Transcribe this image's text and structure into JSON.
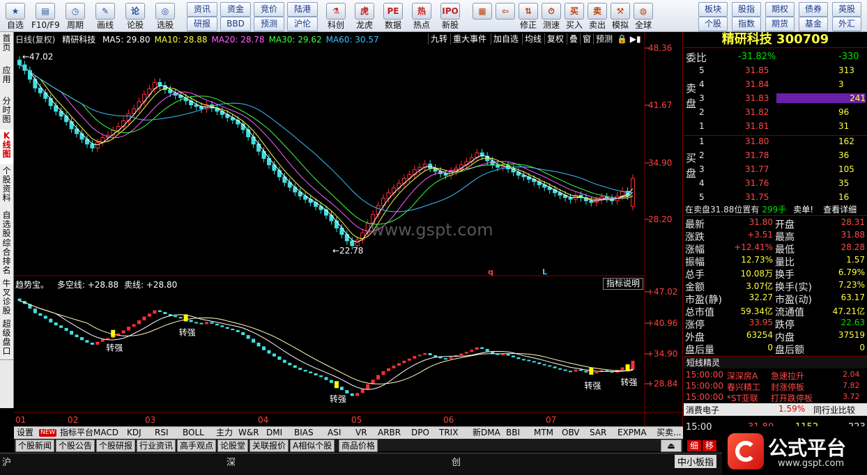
{
  "toolbar": {
    "buttons": [
      {
        "label": "自选",
        "icon": "★"
      },
      {
        "label": "F10/F9",
        "icon": "▤"
      },
      {
        "label": "周期",
        "icon": "◷"
      },
      {
        "label": "画线",
        "icon": "✎"
      },
      {
        "label": "论股",
        "icon": "论"
      },
      {
        "label": "选股",
        "icon": "◎"
      }
    ],
    "quick_links": [
      [
        "资讯",
        "研报"
      ],
      [
        "资金",
        "BBD"
      ],
      [
        "竞价",
        "预测"
      ],
      [
        "陆港",
        "沪伦"
      ]
    ],
    "buttons2": [
      {
        "label": "科创",
        "icon": "⚗"
      },
      {
        "label": "龙虎",
        "icon": "虎"
      },
      {
        "label": "数据",
        "icon": "PE"
      },
      {
        "label": "热点",
        "icon": "热"
      },
      {
        "label": "新股",
        "icon": "IPO"
      }
    ],
    "buttons3": [
      {
        "label": "",
        "icon": "▦"
      },
      {
        "label": "",
        "icon": "⇦"
      },
      {
        "label": "修正",
        "icon": "⇅"
      },
      {
        "label": "测速",
        "icon": "⏱"
      },
      {
        "label": "买入",
        "icon": "买"
      },
      {
        "label": "卖出",
        "icon": "卖"
      },
      {
        "label": "模拟",
        "icon": "⚒"
      },
      {
        "label": "全球",
        "icon": "◍"
      }
    ],
    "right_links": [
      [
        "板块",
        "个股"
      ],
      [
        "股指",
        "指数"
      ],
      [
        "期权",
        "期货"
      ],
      [
        "债券",
        "基金"
      ],
      [
        "英股",
        "外汇"
      ]
    ]
  },
  "left_tabs": [
    "首页",
    "应用",
    "分时图",
    "K线图",
    "个股资料",
    "自选股",
    "综合排名",
    "牛叉诊股",
    "超级盘口"
  ],
  "chart_header": {
    "period": "日线(复权)",
    "name": "精研科技",
    "ma": [
      {
        "label": "MA5: 29.80",
        "color": "#ffffff"
      },
      {
        "label": "MA10: 28.88",
        "color": "#ffff40"
      },
      {
        "label": "MA20: 28.78",
        "color": "#ff60ff"
      },
      {
        "label": "MA30: 29.62",
        "color": "#40ff40"
      },
      {
        "label": "MA60: 30.57",
        "color": "#40c0ff"
      }
    ],
    "tools": [
      "九转",
      "重大事件",
      "加自选",
      "均线",
      "复权",
      "叠",
      "窗",
      "预测"
    ]
  },
  "main_axis": [
    "48.36",
    "41.67",
    "34.90",
    "28.20"
  ],
  "sub_axis": [
    "+47.02",
    "+40.96",
    "+34.90",
    "+28.84"
  ],
  "annotations": {
    "high": "47.02",
    "low": "22.78",
    "watermark": "www.gspt.com",
    "q": "q",
    "L": "L"
  },
  "sub_header": {
    "title": "趋势宝。",
    "duo": "多空线: +28.88",
    "mai": "卖线: +28.80",
    "btn": "指标说明"
  },
  "signals": [
    "转强",
    "转强",
    "转强",
    "转强",
    "转强"
  ],
  "months": [
    "01",
    "02",
    "03",
    "04",
    "05",
    "06",
    "07"
  ],
  "chart_data": {
    "type": "candlestick",
    "closes": [
      46.0,
      45.3,
      44.2,
      43.1,
      42.5,
      41.8,
      40.9,
      40.2,
      39.6,
      38.9,
      38.0,
      37.4,
      36.7,
      36.1,
      35.6,
      36.3,
      36.9,
      37.2,
      37.8,
      38.3,
      39.0,
      39.9,
      40.5,
      41.4,
      42.3,
      43.0,
      43.8,
      43.4,
      42.9,
      42.5,
      42.2,
      41.9,
      41.5,
      41.0,
      40.8,
      40.5,
      41.0,
      40.6,
      40.2,
      39.8,
      39.4,
      39.1,
      38.6,
      37.9,
      37.0,
      36.1,
      35.2,
      34.3,
      33.5,
      32.8,
      32.0,
      31.3,
      30.7,
      30.1,
      29.6,
      29.2,
      28.8,
      28.3,
      27.9,
      27.2,
      26.5,
      25.6,
      24.8,
      24.0,
      23.4,
      24.1,
      25.0,
      26.2,
      27.3,
      28.4,
      29.3,
      30.0,
      30.6,
      31.2,
      31.8,
      32.3,
      32.9,
      33.2,
      33.6,
      33.1,
      32.7,
      32.4,
      32.2,
      32.7,
      33.1,
      33.5,
      33.9,
      34.4,
      35.0,
      34.6,
      34.0,
      33.5,
      33.2,
      33.4,
      33.0,
      32.6,
      32.2,
      32.0,
      31.7,
      31.4,
      31.0,
      30.7,
      30.4,
      30.0,
      29.7,
      29.4,
      29.2,
      29.7,
      29.4,
      29.0,
      28.8,
      29.1,
      29.5,
      29.3,
      29.0,
      29.6,
      30.2,
      29.6,
      31.8
    ],
    "ylim": [
      20.5,
      48.36
    ],
    "ma_values": {
      "MA5": 29.8,
      "MA10": 28.88,
      "MA20": 28.78,
      "MA30": 29.62,
      "MA60": 30.57
    },
    "high": 47.02,
    "low": 22.78
  },
  "quote": {
    "title": "精研科技 300709",
    "weibi_label": "委比",
    "weibi": "-31.82%",
    "weicha": "-330",
    "sell_label": "卖盘",
    "buy_label": "买盘",
    "sells": [
      [
        "5",
        "31.85",
        "313"
      ],
      [
        "4",
        "31.84",
        "3"
      ],
      [
        "3",
        "31.83",
        "241"
      ],
      [
        "2",
        "31.82",
        "96"
      ],
      [
        "1",
        "31.81",
        "31"
      ]
    ],
    "buys": [
      [
        "1",
        "31.80",
        "162"
      ],
      [
        "2",
        "31.78",
        "36"
      ],
      [
        "3",
        "31.77",
        "105"
      ],
      [
        "4",
        "31.76",
        "35"
      ],
      [
        "5",
        "31.75",
        "16"
      ]
    ],
    "notice": "在卖盘31.88位置有",
    "notice_vol": "299手",
    "notice_tag": "卖单!",
    "notice_link": "查看详细",
    "stats": [
      [
        "最新",
        "31.80",
        "开盘",
        "28.31"
      ],
      [
        "涨跌",
        "+3.51",
        "最高",
        "31.88"
      ],
      [
        "涨幅",
        "+12.41%",
        "最低",
        "28.28"
      ],
      [
        "振幅",
        "12.73%",
        "量比",
        "1.57"
      ],
      [
        "总手",
        "10.08万",
        "换手",
        "6.79%"
      ],
      [
        "金额",
        "3.07亿",
        "换手(实)",
        "7.23%"
      ],
      [
        "市盈(静)",
        "32.27",
        "市盈(动)",
        "63.17"
      ],
      [
        "总市值",
        "59.34亿",
        "流通值",
        "47.21亿"
      ],
      [
        "涨停",
        "33.95",
        "跌停",
        "22.63"
      ],
      [
        "外盘",
        "63254",
        "内盘",
        "37519"
      ],
      [
        "盘后量",
        "0",
        "盘后额",
        "0"
      ]
    ],
    "elf_title": "短线精灵",
    "elf": [
      [
        "15:00:00",
        "深深房A",
        "急速拉升",
        "2.04"
      ],
      [
        "15:00:00",
        "春兴精工",
        "封涨停板",
        "7.82"
      ],
      [
        "15:00:00",
        "*ST亚联",
        "打开跌停板",
        "3.72"
      ]
    ],
    "sector": "消费电子",
    "sector_pct": "1.59%",
    "sector_btn": "同行业比较",
    "tick": [
      "15:00",
      "31.80",
      "1152",
      "223"
    ],
    "detail_tabs": [
      "细",
      "移"
    ]
  },
  "indicator_tabs": [
    "设置",
    "NEW",
    "指标平台",
    "MACD",
    "KDJ",
    "RSI",
    "BOLL",
    "主力",
    "W&R",
    "DMI",
    "BIAS",
    "ASI",
    "VR",
    "ARBR",
    "DPO",
    "TRIX",
    "新DMA",
    "BBI",
    "MTM",
    "OBV",
    "SAR",
    "EXPMA",
    "买卖..."
  ],
  "info_tabs": [
    "个股新闻",
    "个股公告",
    "个股研报",
    "行业资讯",
    "高手观点",
    "论股堂",
    "关联报价",
    "A相似个股",
    "商品价格"
  ],
  "status": [
    "沪",
    "深",
    "创",
    "中小板指"
  ],
  "logo": {
    "text": "公式平台",
    "url": "www.gspt.com"
  }
}
